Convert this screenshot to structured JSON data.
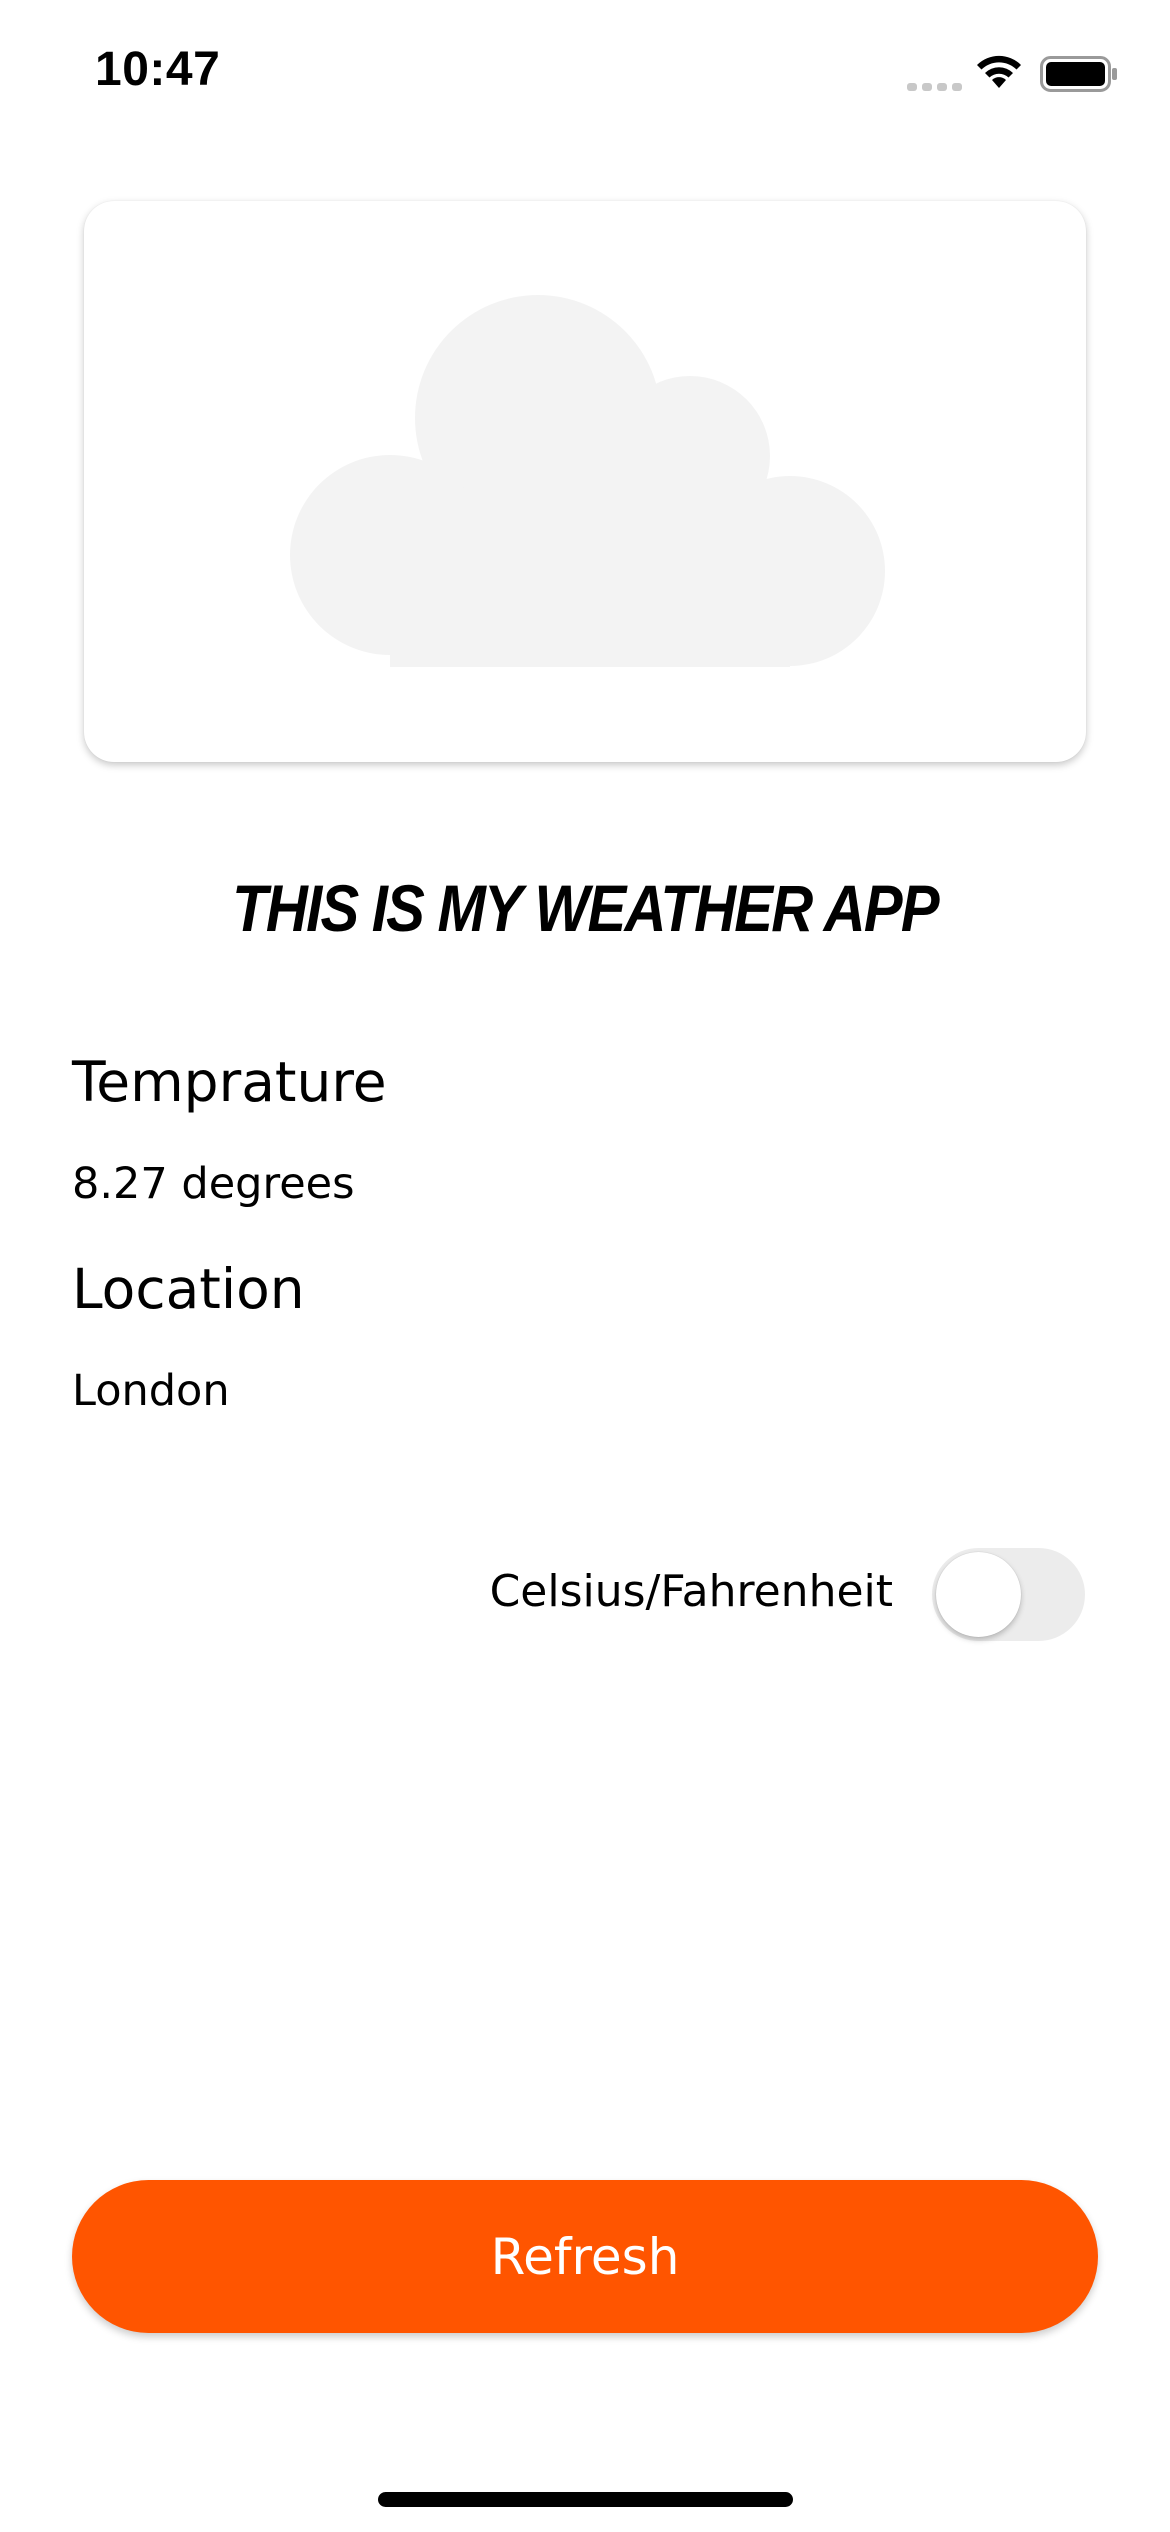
{
  "status_bar": {
    "time": "10:47",
    "signal_icon": "cellular-signal-icon",
    "wifi_icon": "wifi-icon",
    "battery_icon": "battery-icon"
  },
  "hero": {
    "icon": "cloud-icon",
    "icon_color": "#f3f3f3"
  },
  "title": "THIS IS MY WEATHER APP",
  "temperature": {
    "heading": "Temprature",
    "value": "8.27 degrees"
  },
  "location": {
    "heading": "Location",
    "value": "London"
  },
  "unit_toggle": {
    "label": "Celsius/Fahrenheit",
    "on": false
  },
  "refresh_button": {
    "label": "Refresh",
    "color": "#ff5500"
  }
}
